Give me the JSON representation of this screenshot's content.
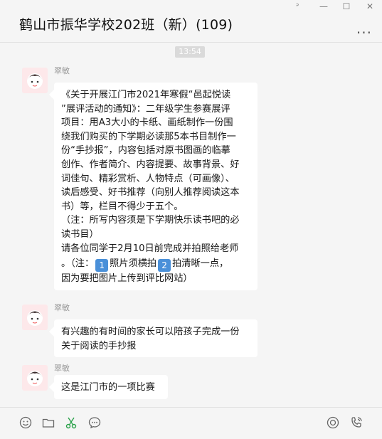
{
  "window": {
    "title": "鹤山市振华学校202班（新）(109)",
    "more": "...",
    "pin": "ᐣ",
    "minimize": "—",
    "maximize": "☐",
    "close": "✕"
  },
  "chat": {
    "time": "13:54",
    "messages": [
      {
        "sender": "翠敏",
        "text_lines": [
          "《关于开展江门市2021年寒假“邑起悦读",
          "”展评活动的通知》：二年级学生参赛展评",
          "项目：用A3大小的卡纸、画纸制作一份围",
          "绕我们购买的下学期必读那5本书目制作一",
          "份“手抄报”，内容包括对原书图画的临摹",
          "创作、作者简介、内容提要、故事背景、好",
          "词佳句、精彩赏析、人物特点（可画像）、",
          "读后感受、好书推荐（向别人推荐阅读这本",
          "书）等，栏目不得少于五个。",
          "（注：所写内容须是下学期快乐读书吧的必",
          "读书目）",
          "请各位同学于2月10日前完成并拍照给老师"
        ],
        "note_prefix": "。（注：",
        "num1": "1",
        "note_mid": "照片须横拍",
        "num2": "2",
        "note_suffix": "拍清晰一点，",
        "last_line": "因为要把图片上传到评比网站）"
      },
      {
        "sender": "翠敏",
        "text_lines": [
          "有兴趣的有时间的家长可以陪孩子完成一份",
          "关于阅读的手抄报"
        ]
      },
      {
        "sender": "翠敏",
        "text_lines": [
          "这是江门市的一项比赛"
        ]
      }
    ]
  },
  "toolbar": {
    "icons": [
      "emoji-icon",
      "folder-icon",
      "scissors-icon",
      "chat-bubble-icon",
      "live-icon",
      "phone-icon"
    ]
  }
}
